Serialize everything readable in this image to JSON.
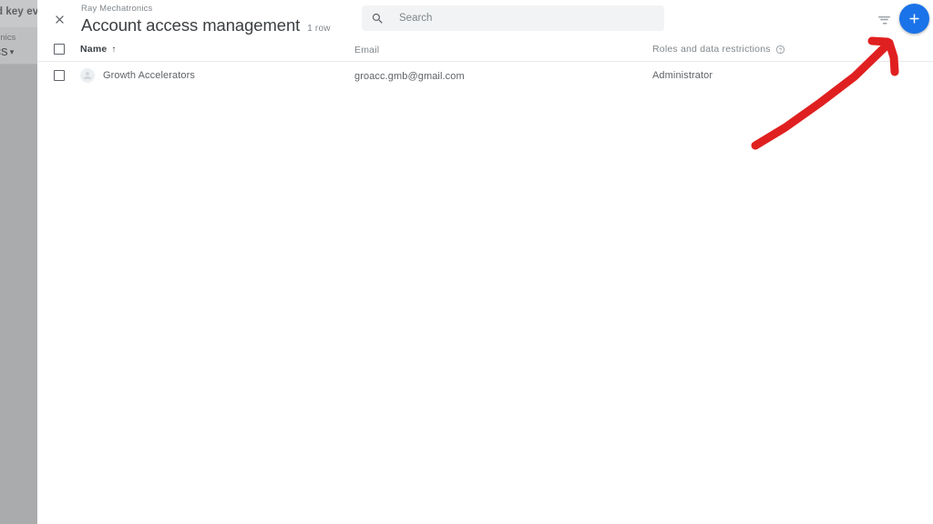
{
  "background_page": {
    "text_fragment_top": "d key eve",
    "text_fragment_account": "atronics",
    "text_fragment_selector": "nics",
    "caret_glyph": "▾",
    "overlay_color": "#a9abad"
  },
  "header": {
    "close_icon": "close-icon",
    "account_name": "Ray Mechatronics",
    "title": "Account access management",
    "row_count": "1 row",
    "search": {
      "icon": "search-icon",
      "value": "",
      "placeholder": "Search"
    },
    "filter_icon": "filter-list-icon",
    "add_button": {
      "icon": "plus-icon",
      "label": "+",
      "color": "#1a73e8"
    }
  },
  "table": {
    "select_all_checkbox": "",
    "columns": [
      {
        "key": "name",
        "label": "Name",
        "sorted": true,
        "sort_arrow": "↑"
      },
      {
        "key": "email",
        "label": "Email",
        "sorted": false
      },
      {
        "key": "roles",
        "label": "Roles and data restrictions",
        "sorted": false,
        "help_icon": "help-circle-icon"
      }
    ],
    "rows": [
      {
        "checkbox": "",
        "avatar": "person-avatar-icon",
        "name": "Growth Accelerators",
        "email": "groacc.gmb@gmail.com",
        "roles": "Administrator"
      }
    ]
  },
  "annotation": {
    "type": "hand-drawn-arrow",
    "color": "#e02020",
    "points_to": "add-button",
    "stroke_width": 9
  },
  "colors": {
    "accent_blue": "#1a73e8",
    "text_primary": "#3c4043",
    "text_secondary": "#5f6368",
    "text_muted": "#80868b",
    "divider": "#e8eaed",
    "search_bg": "#f1f3f4",
    "annotation_red": "#e02020"
  }
}
